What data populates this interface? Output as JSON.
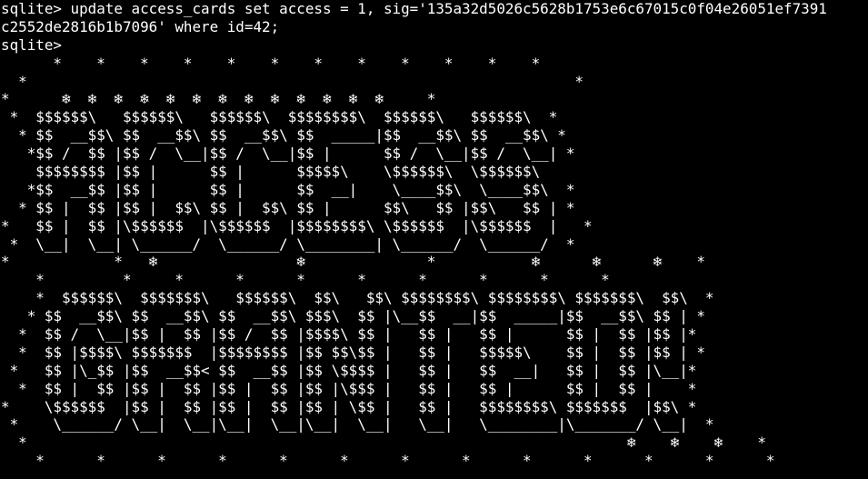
{
  "terminal": {
    "foreground": "#ffffff",
    "background": "#000000",
    "command_lines": [
      "sqlite> update access_cards set access = 1, sig='135a32d5026c5628b1753e6c67015c0f04e26051ef7391",
      "c2552de2816b1b7096' where id=42;",
      "sqlite>"
    ],
    "banner_lines": [
      "      *    *    *    *    *    *    *    *    *    *    *    *",
      "  *                                                               *",
      "*      ❄  ❄  ❄  ❄  ❄  ❄  ❄  ❄  ❄  ❄  ❄  ❄  ❄     *",
      " *  $$$$$$\\   $$$$$$\\   $$$$$$\\  $$$$$$$$\\  $$$$$$\\   $$$$$$\\  *",
      "  * $$  __$$\\ $$  __$$\\ $$  __$$\\ $$  _____|$$  __$$\\ $$  __$$\\ *",
      "   *$$ /  $$ |$$ /  \\__|$$ /  \\__|$$ |      $$ /  \\__|$$ /  \\__| *",
      "    $$$$$$$$ |$$ |      $$ |      $$$$$\\    \\$$$$$$\\  \\$$$$$$\\",
      "   *$$  __$$ |$$ |      $$ |      $$  __|    \\____$$\\  \\____$$\\  *",
      "  * $$ |  $$ |$$ |  $$\\ $$ |  $$\\ $$ |      $$\\   $$ |$$\\   $$ | *",
      "*   $$ |  $$ |\\$$$$$$  |\\$$$$$$  |$$$$$$$$\\ \\$$$$$$  |\\$$$$$$  |   *",
      " *  \\__|  \\__| \\______/  \\______/ \\________| \\______/  \\______/  *",
      "*            *   ❄                ❄              *           ❄      ❄      ❄    *",
      "    *         *     *      *      *      *      *      *      *      *",
      "    *  $$$$$$\\  $$$$$$$\\   $$$$$$\\  $$\\   $$\\ $$$$$$$$\\ $$$$$$$$\\ $$$$$$$\\  $$\\  *",
      "   * $$  __$$\\ $$  __$$\\ $$  __$$\\ $$$\\  $$ |\\__$$  __|$$  _____|$$  __$$\\ $$ | *",
      "  *  $$ /  \\__|$$ |  $$ |$$ /  $$ |$$$$\\ $$ |   $$ |   $$ |      $$ |  $$ |$$ |*",
      "  *  $$ |$$$$\\ $$$$$$$  |$$$$$$$$ |$$ $$\\$$ |   $$ |   $$$$$\\    $$ |  $$ |$$ | *",
      " *   $$ |\\_$$ |$$  __$$< $$  __$$ |$$ \\$$$$ |   $$ |   $$  __|   $$ |  $$ |\\__|*",
      "  *  $$ |  $$ |$$ |  $$ |$$ |  $$ |$$ |\\$$$ |   $$ |   $$ |      $$ |  $$ |    *",
      "*    \\$$$$$$  |$$ |  $$ |$$ |  $$ |$$ | \\$$ |   $$ |   $$$$$$$$\\ $$$$$$$  |$$\\ *",
      " *    \\______/ \\__|  \\__|\\__|  \\__|\\__|  \\__|   \\__|   \\________|\\_______/ \\__|  *",
      "  *                                                                     ❄    ❄    ❄    *",
      "    *      *      *      *      *      *      *      *      *      *      *      *      *"
    ]
  }
}
